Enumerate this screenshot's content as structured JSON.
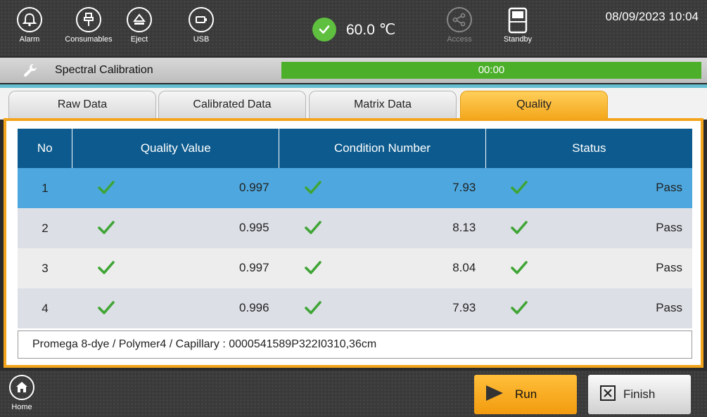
{
  "topbar": {
    "buttons": [
      {
        "label": "Alarm",
        "icon": "bell-icon"
      },
      {
        "label": "Consumables",
        "icon": "consumables-icon"
      },
      {
        "label": "Eject",
        "icon": "eject-icon"
      },
      {
        "label": "USB",
        "icon": "usb-icon"
      }
    ],
    "temperature": "60.0 ℃",
    "temperature_status_icon": "check-circle-icon",
    "access_label": "Access",
    "standby_label": "Standby",
    "datetime": "08/09/2023 10:04"
  },
  "titlebar": {
    "title": "Spectral Calibration",
    "progress_text": "00:00",
    "progress_fraction": 1.0
  },
  "tabs": [
    {
      "label": "Raw Data",
      "active": false
    },
    {
      "label": "Calibrated Data",
      "active": false
    },
    {
      "label": "Matrix Data",
      "active": false
    },
    {
      "label": "Quality",
      "active": true
    }
  ],
  "table": {
    "headers": {
      "no": "No",
      "quality": "Quality Value",
      "condition": "Condition Number",
      "status": "Status"
    },
    "rows": [
      {
        "no": "1",
        "quality": "0.997",
        "condition": "7.93",
        "status": "Pass",
        "selected": true
      },
      {
        "no": "2",
        "quality": "0.995",
        "condition": "8.13",
        "status": "Pass"
      },
      {
        "no": "3",
        "quality": "0.997",
        "condition": "8.04",
        "status": "Pass"
      },
      {
        "no": "4",
        "quality": "0.996",
        "condition": "7.93",
        "status": "Pass"
      }
    ]
  },
  "info_text": "Promega 8-dye / Polymer4 /  Capillary : 0000541589P322I0310,36cm",
  "bottombar": {
    "home_label": "Home",
    "run_label": "Run",
    "finish_label": "Finish"
  },
  "colors": {
    "accent_orange": "#f2a51c",
    "header_blue": "#0d5b8e",
    "selected_row": "#4ea8df",
    "progress_green": "#4caf2a",
    "check_green": "#3fa535"
  }
}
